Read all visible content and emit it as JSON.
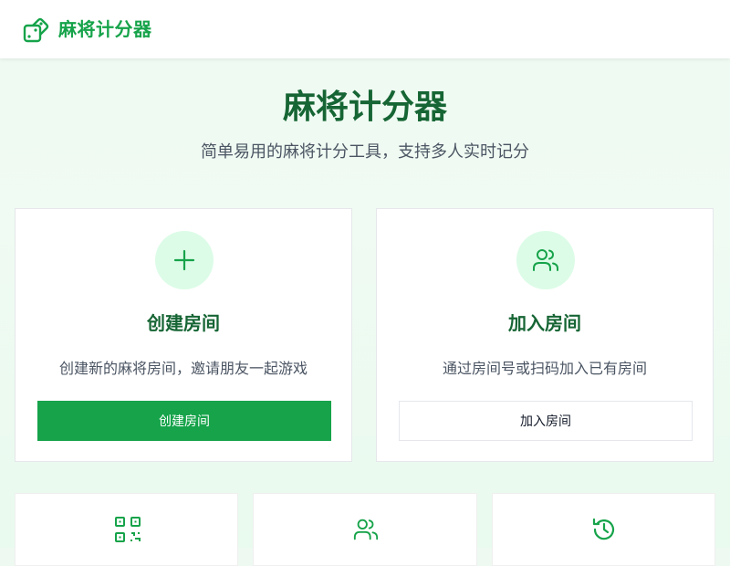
{
  "header": {
    "app_name": "麻将计分器",
    "logo_icon": "dice-icon"
  },
  "hero": {
    "title": "麻将计分器",
    "subtitle": "简单易用的麻将计分工具，支持多人实时记分"
  },
  "cards": [
    {
      "icon": "plus-icon",
      "title": "创建房间",
      "description": "创建新的麻将房间，邀请朋友一起游戏",
      "button_label": "创建房间"
    },
    {
      "icon": "users-icon",
      "title": "加入房间",
      "description": "通过房间号或扫码加入已有房间",
      "button_label": "加入房间"
    }
  ],
  "features": [
    {
      "icon": "qrcode-icon"
    },
    {
      "icon": "users-icon"
    },
    {
      "icon": "history-icon"
    }
  ],
  "colors": {
    "accent": "#16a34a",
    "title": "#166534",
    "icon_bg": "#dcfce7"
  }
}
